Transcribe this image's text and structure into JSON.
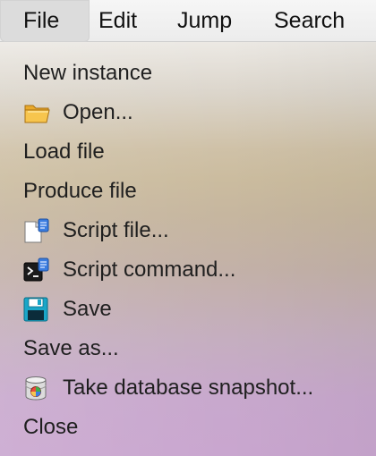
{
  "menubar": {
    "items": [
      {
        "label": "File",
        "active": true
      },
      {
        "label": "Edit",
        "active": false
      },
      {
        "label": "Jump",
        "active": false
      },
      {
        "label": "Search",
        "active": false
      }
    ]
  },
  "file_menu": {
    "items": [
      {
        "label": "New instance",
        "icon": null
      },
      {
        "label": "Open...",
        "icon": "folder-icon"
      },
      {
        "label": "Load file",
        "icon": null
      },
      {
        "label": "Produce file",
        "icon": null
      },
      {
        "label": "Script file...",
        "icon": "script-file-icon"
      },
      {
        "label": "Script command...",
        "icon": "script-command-icon"
      },
      {
        "label": "Save",
        "icon": "floppy-disk-icon"
      },
      {
        "label": "Save as...",
        "icon": null
      },
      {
        "label": "Take database snapshot...",
        "icon": "database-snapshot-icon"
      },
      {
        "label": "Close",
        "icon": null
      }
    ]
  },
  "colors": {
    "menubar_bg": "#f2f2f2",
    "active_menu_bg": "#dcdcdc",
    "menu_text": "#1f1f1f"
  }
}
